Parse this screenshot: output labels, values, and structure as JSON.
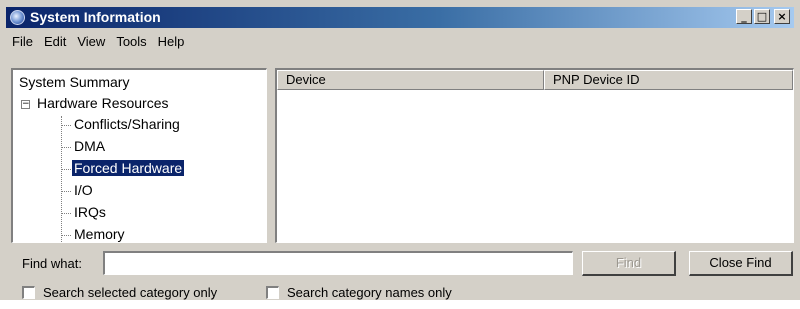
{
  "window": {
    "title": "System Information",
    "icon": "system-info-icon",
    "controls": {
      "minimize": "_",
      "maximize": "□",
      "close": "×"
    }
  },
  "menu": [
    "File",
    "Edit",
    "View",
    "Tools",
    "Help"
  ],
  "tree": {
    "root": "System Summary",
    "expander": "−",
    "group": "Hardware Resources",
    "children": [
      "Conflicts/Sharing",
      "DMA",
      "Forced Hardware",
      "I/O",
      "IRQs",
      "Memory"
    ],
    "selected": "Forced Hardware"
  },
  "list": {
    "columns": [
      "Device",
      "PNP Device ID"
    ]
  },
  "find": {
    "label": "Find what:",
    "value": "",
    "find_button": "Find",
    "close_button": "Close Find",
    "check_selected_category": "Search selected category only",
    "check_category_names": "Search category names only"
  },
  "colors": {
    "window_face": "#d4d0c8",
    "titlebar_start": "#0a246a",
    "selection": "#0a246a"
  }
}
